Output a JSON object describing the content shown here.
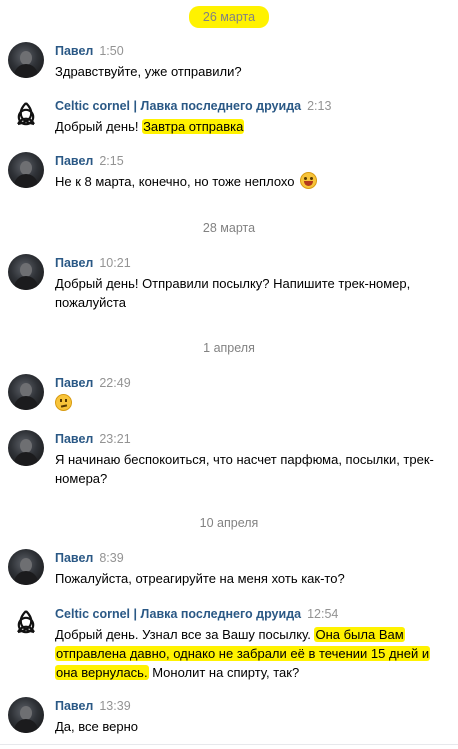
{
  "dates": [
    "26 марта",
    "28 марта",
    "1 апреля",
    "10 апреля"
  ],
  "messages": [
    {
      "author": "Павел",
      "time": "1:50",
      "text": "Здравствуйте, уже отправили?"
    },
    {
      "author": "Celtic cornel | Лавка последнего друида",
      "time": "2:13",
      "text_before": "Добрый день! ",
      "text_highlight": "Завтра отправка"
    },
    {
      "author": "Павел",
      "time": "2:15",
      "text": "Не к 8 марта, конечно, но тоже неплохо",
      "emoji": "laughing-face-emoji"
    },
    {
      "author": "Павел",
      "time": "10:21",
      "text": "Добрый день! Отправили посылку? Напишите трек-номер, пожалуйста"
    },
    {
      "author": "Павел",
      "time": "22:49",
      "emoji": "thinking-face-emoji"
    },
    {
      "author": "Павел",
      "time": "23:21",
      "text": "Я начинаю беспокоиться, что насчет парфюма, посылки, трек-номера?"
    },
    {
      "author": "Павел",
      "time": "8:39",
      "text": "Пожалуйста, отреагируйте на меня хоть как-то?"
    },
    {
      "author": "Celtic cornel | Лавка последнего друида",
      "time": "12:54",
      "text_before": "Добрый день. Узнал все за Вашу посылку. ",
      "text_highlight": "Она была Вам отправлена давно, однако не забрали её в течении 15 дней и она вернулась.",
      "text_after": " Монолит на спирту, так?"
    },
    {
      "author": "Павел",
      "time": "13:39",
      "text": "Да, все верно"
    }
  ],
  "colors": {
    "author": "#2a5885",
    "time": "#939393",
    "highlight": "#fff200",
    "date": "#828282"
  }
}
